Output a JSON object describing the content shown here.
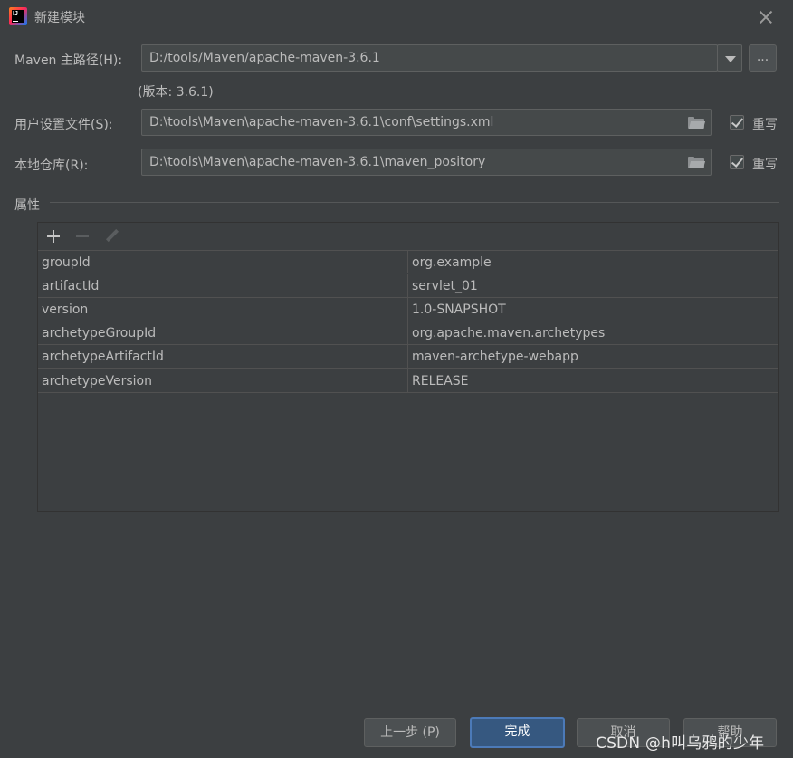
{
  "window": {
    "title": "新建模块",
    "app_icon_text": "IJ"
  },
  "form": {
    "maven_home": {
      "label": "Maven 主路径(H):",
      "value": "D:/tools/Maven/apache-maven-3.6.1",
      "browse_label": "...",
      "version_note": "(版本: 3.6.1)"
    },
    "user_settings": {
      "label": "用户设置文件(S):",
      "value": "D:\\tools\\Maven\\apache-maven-3.6.1\\conf\\settings.xml",
      "override_label": "重写",
      "override_checked": true
    },
    "local_repo": {
      "label": "本地仓库(R):",
      "value": "D:\\tools\\Maven\\apache-maven-3.6.1\\maven_pository",
      "override_label": "重写",
      "override_checked": true
    }
  },
  "properties": {
    "section_label": "属性",
    "toolbar": {
      "add_icon": "plus-icon",
      "remove_icon": "minus-icon",
      "edit_icon": "pencil-icon"
    },
    "rows": [
      {
        "key": "groupId",
        "value": "org.example"
      },
      {
        "key": "artifactId",
        "value": "servlet_01"
      },
      {
        "key": "version",
        "value": "1.0-SNAPSHOT"
      },
      {
        "key": "archetypeGroupId",
        "value": "org.apache.maven.archetypes"
      },
      {
        "key": "archetypeArtifactId",
        "value": "maven-archetype-webapp"
      },
      {
        "key": "archetypeVersion",
        "value": "RELEASE"
      }
    ]
  },
  "buttons": {
    "previous": "上一步 (P)",
    "finish": "完成",
    "cancel": "取消",
    "help": "帮助"
  },
  "watermark": "CSDN @h叫乌鸦的少年",
  "colors": {
    "background": "#3c3f41",
    "field_bg": "#45494a",
    "primary_button": "#365880",
    "text": "#bbbbbb"
  }
}
